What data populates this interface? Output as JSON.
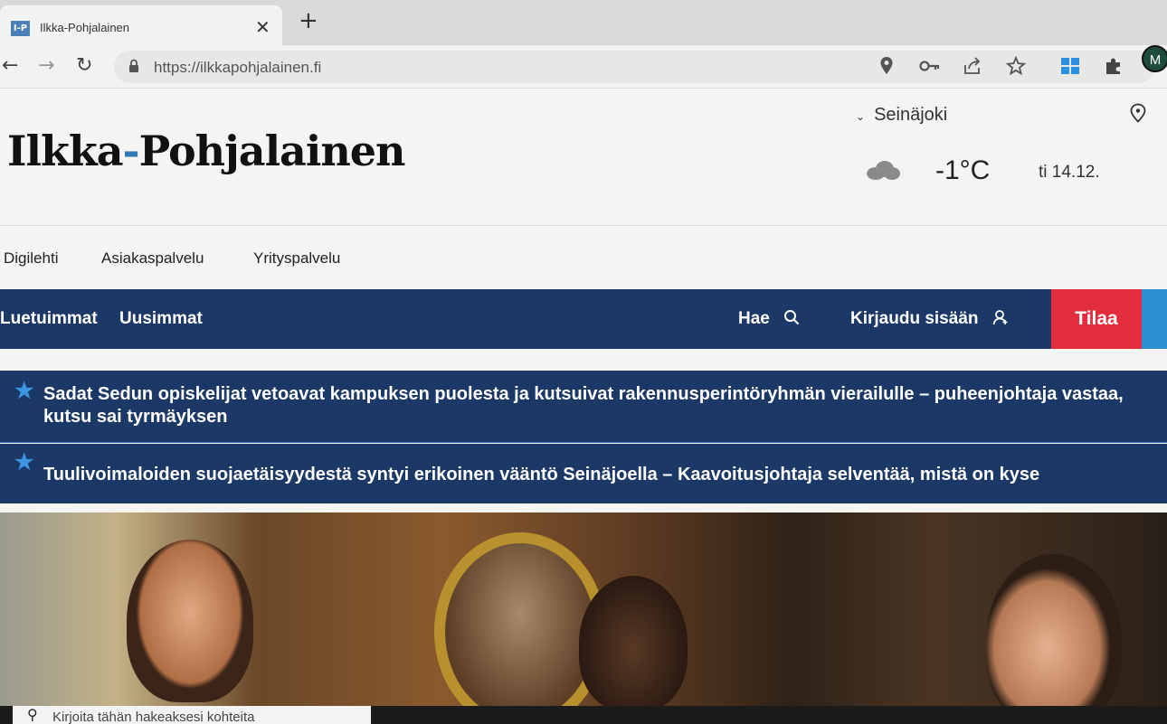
{
  "browser": {
    "tab_title": "Ilkka-Pohjalainen",
    "favicon_text": "I-P",
    "close_glyph": "✕",
    "new_tab_glyph": "+",
    "url": "https://ilkkapohjalainen.fi",
    "nav_icons": {
      "back": "←",
      "forward": "→",
      "reload": "↻"
    },
    "profile_initial": "M"
  },
  "header": {
    "logo_part1": "Ilkka",
    "logo_dot": "-",
    "logo_part2": "Pohjalainen",
    "weather": {
      "city": "Seinäjoki",
      "chevron": "⌄",
      "location_icon": "⊙",
      "temperature": "-1°C",
      "date": "ti 14.12.",
      "condition_icon": "cloud-icon"
    }
  },
  "subnav": {
    "items": [
      "Digilehti",
      "Asiakaspalvelu",
      "Yrityspalvelu"
    ]
  },
  "mainnav": {
    "items": [
      "Luetuimmat",
      "Uusimmat"
    ],
    "search_label": "Hae",
    "search_icon": "⌕",
    "login_label": "Kirjaudu sisään",
    "login_icon": "⚇",
    "subscribe_label": "Tilaa"
  },
  "breaking": [
    {
      "star": "★",
      "headline": "Sadat Sedun opiskelijat vetoavat kampuksen puolesta ja kutsuivat rakennusperintöryhmän vierailulle – puheenjohtaja vastaa, kutsu sai tyrmäyksen"
    },
    {
      "star": "★",
      "headline": "Tuulivoimaloiden suojaetäisyydestä syntyi erikoinen vääntö Seinäjoella – Kaavoitusjohtaja selventää, mistä on kyse"
    }
  ],
  "taskbar": {
    "search_placeholder": "Kirjoita tähän hakeaksesi kohteita",
    "search_icon": "⚲"
  },
  "colors": {
    "nav_blue": "#1c3866",
    "subscribe_red": "#e42d3c",
    "star_blue": "#3c95e0",
    "logo_dot_blue": "#2f78b3"
  }
}
